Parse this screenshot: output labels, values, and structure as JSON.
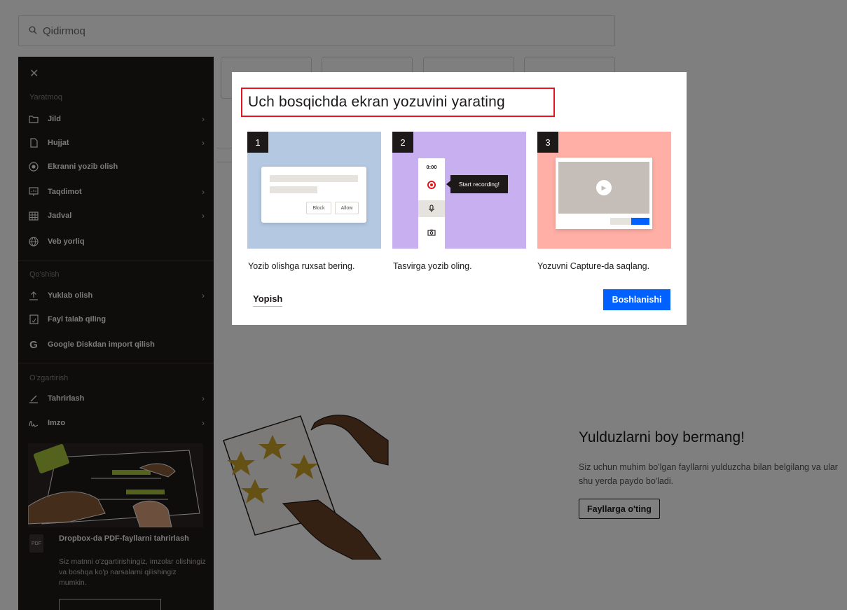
{
  "search": {
    "placeholder": "Qidirmoq"
  },
  "side_menu": {
    "sections": {
      "create": "Yaratmoq",
      "add": "Qo'shish",
      "edit": "O'zgartirish"
    },
    "create_items": [
      {
        "label": "Jild",
        "icon": "folder-icon",
        "has_submenu": true
      },
      {
        "label": "Hujjat",
        "icon": "document-icon",
        "has_submenu": true
      },
      {
        "label": "Ekranni yozib olish",
        "icon": "record-icon",
        "has_submenu": false
      },
      {
        "label": "Taqdimot",
        "icon": "presentation-icon",
        "has_submenu": true
      },
      {
        "label": "Jadval",
        "icon": "table-icon",
        "has_submenu": true
      },
      {
        "label": "Veb yorliq",
        "icon": "globe-icon",
        "has_submenu": false
      }
    ],
    "add_items": [
      {
        "label": "Yuklab olish",
        "icon": "upload-icon",
        "has_submenu": true
      },
      {
        "label": "Fayl talab qiling",
        "icon": "file-request-icon",
        "has_submenu": false
      },
      {
        "label": "Google Diskdan import qilish",
        "icon": "google-icon",
        "has_submenu": false
      }
    ],
    "edit_items": [
      {
        "label": "Tahrirlash",
        "icon": "pencil-icon",
        "has_submenu": true
      },
      {
        "label": "Imzo",
        "icon": "signature-icon",
        "has_submenu": true
      }
    ],
    "promo_card": {
      "icon_label": "PDF",
      "title": "Dropbox-da PDF-fayllarni tahrirlash",
      "text": "Siz matnni o'zgartirishingiz, imzolar olishingiz va boshqa ko'p narsalarni qilishingiz mumkin."
    }
  },
  "starred_promo": {
    "title": "Yulduzlarni boy bermang!",
    "text": "Siz uchun muhim bo'lgan fayllarni yulduzcha bilan belgilang va ular shu yerda paydo bo'ladi.",
    "button": "Fayllarga o'ting"
  },
  "modal": {
    "title": "Uch bosqichda ekran yozuvini yarating",
    "steps": [
      {
        "number": "1",
        "caption": "Yozib olishga ruxsat bering.",
        "color": "#b4c8e1",
        "buttons": [
          "Block",
          "Allow"
        ]
      },
      {
        "number": "2",
        "caption": "Tasvirga yozib oling.",
        "color": "#c8aff0",
        "timer": "0:00",
        "tooltip": "Start recording!"
      },
      {
        "number": "3",
        "caption": "Yozuvni Capture-da saqlang.",
        "color": "#ffafa5"
      }
    ],
    "close_label": "Yopish",
    "start_label": "Boshlanishi",
    "accent": "#0061fe",
    "highlight": "#e0171f"
  }
}
